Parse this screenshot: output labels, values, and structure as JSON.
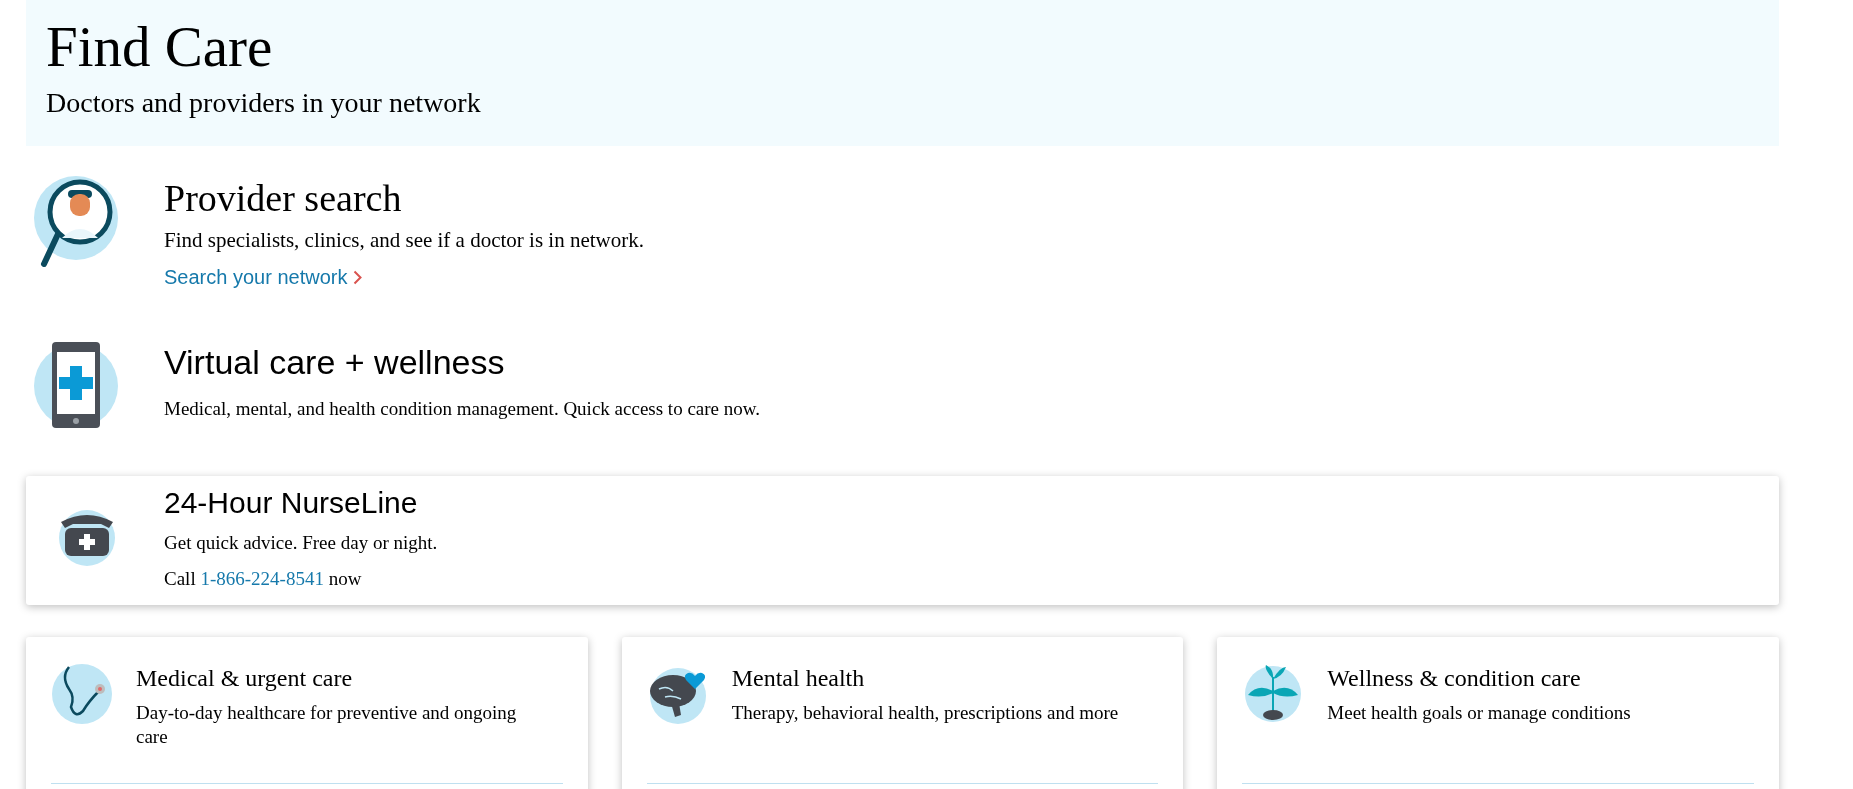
{
  "header": {
    "title": "Find Care",
    "subtitle": "Doctors and providers in your network"
  },
  "sections": [
    {
      "kind": "search",
      "title": "Provider search",
      "description": "Find specialists, clinics, and see if a doctor is in network.",
      "link": "Search your network"
    },
    {
      "kind": "virtual",
      "title": "Virtual care + wellness",
      "description": "Medical, mental, and health condition management. Quick access to care now."
    }
  ],
  "nurseline": {
    "title": "24-Hour NurseLine",
    "description": "Get quick advice. Free day or night.",
    "call_prefix": "Call",
    "phone": "1-866-224-8541",
    "call_suffix": "now"
  },
  "cards": [
    {
      "kind": "stethoscope",
      "title": "Medical & urgent care",
      "description": "Day-to-day healthcare for preventive and ongoing care"
    },
    {
      "kind": "brain",
      "title": "Mental health",
      "description": "Therapy, behavioral health, prescriptions and more"
    },
    {
      "kind": "plant",
      "title": "Wellness & condition care",
      "description": "Meet health goals or manage conditions"
    }
  ]
}
